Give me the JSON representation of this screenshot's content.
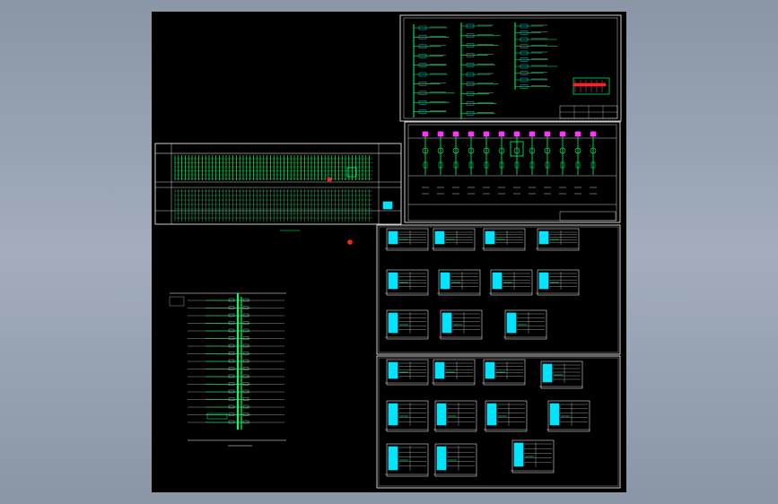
{
  "viewport": {
    "background_color": "#98a3b3",
    "drawing_background": "#000000"
  },
  "colors": {
    "frame": "#ffffff",
    "wire": "#00ff66",
    "cyan": "#00e5ff",
    "magenta": "#ff33ff",
    "red": "#ff2222",
    "yellow": "#ffff33"
  },
  "sheets": [
    {
      "id": "system-schematic",
      "kind": "schematic"
    },
    {
      "id": "distribution-table",
      "kind": "table"
    },
    {
      "id": "panel-elevation",
      "kind": "single-line"
    },
    {
      "id": "riser-diagram",
      "kind": "riser"
    },
    {
      "id": "box-schedule-1",
      "kind": "box-grid"
    },
    {
      "id": "box-schedule-2",
      "kind": "box-grid"
    }
  ]
}
